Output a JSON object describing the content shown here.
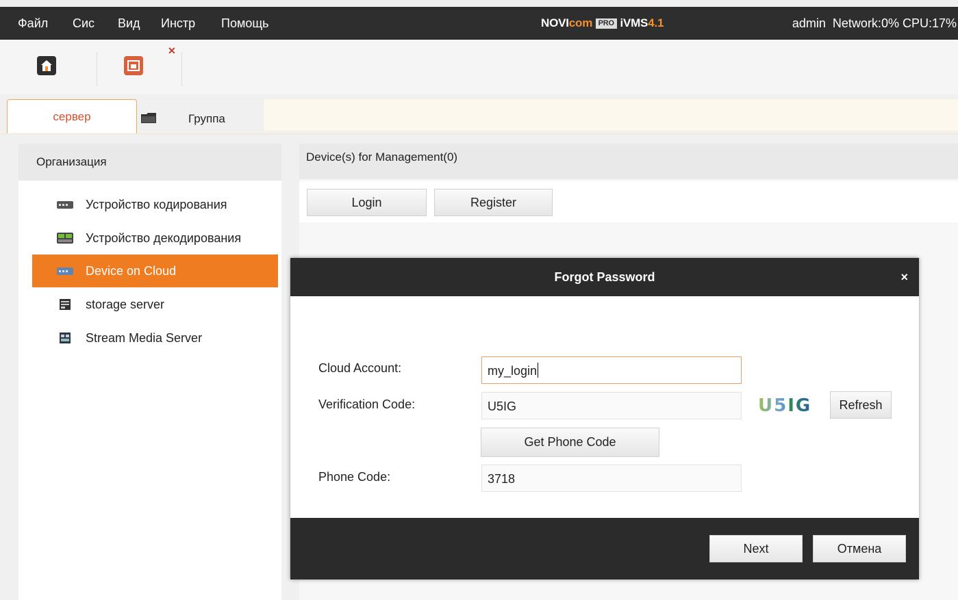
{
  "menu": [
    "Файл",
    "Сис",
    "Вид",
    "Инстр",
    "Помощь"
  ],
  "brand": {
    "part1": "NOVI",
    "part2": "com",
    "pro": "PRO",
    "product": "iVMS",
    "version": "4.1"
  },
  "status": {
    "user": "admin",
    "network": "Network:0%",
    "cpu": "CPU:17%"
  },
  "tabs": {
    "server": "сервер",
    "group": "Группа"
  },
  "left_panel": {
    "header": "Организация",
    "items": [
      {
        "label": "Устройство кодирования",
        "icon": "encoder-device-icon"
      },
      {
        "label": "Устройство декодирования",
        "icon": "decoder-device-icon"
      },
      {
        "label": "Device on Cloud",
        "icon": "cloud-device-icon",
        "selected": true
      },
      {
        "label": "storage server",
        "icon": "storage-server-icon"
      },
      {
        "label": "Stream Media Server",
        "icon": "stream-media-server-icon"
      }
    ]
  },
  "main": {
    "header": "Device(s) for Management(0)",
    "login_label": "Login",
    "register_label": "Register"
  },
  "dialog": {
    "title": "Forgot Password",
    "close_symbol": "×",
    "cloud_account_label": "Cloud Account:",
    "cloud_account_value": "my_login",
    "verification_label": "Verification Code:",
    "verification_value": "U5IG",
    "captcha_text": "U5IG",
    "refresh_label": "Refresh",
    "get_phone_code_label": "Get Phone Code",
    "phone_code_label": "Phone Code:",
    "phone_code_value": "3718",
    "next_label": "Next",
    "cancel_label": "Отмена"
  },
  "colors": {
    "accent": "#f07c22",
    "dark": "#2b2b2b",
    "tab_text": "#d0502f"
  }
}
